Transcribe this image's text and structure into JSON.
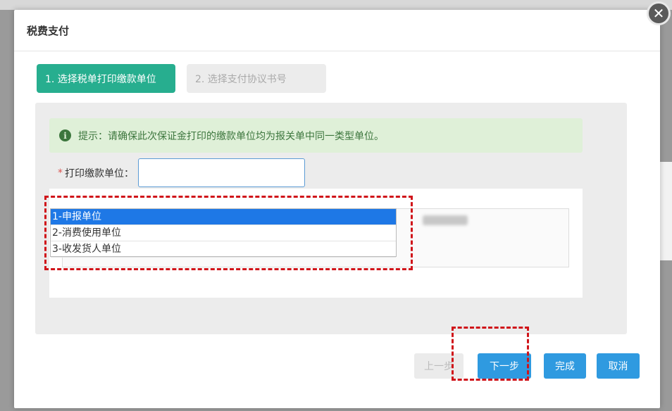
{
  "modal": {
    "title": "税费支付",
    "close_label": "✕"
  },
  "steps": [
    {
      "label": "1. 选择税单打印缴款单位",
      "active": true
    },
    {
      "label": "2. 选择支付协议书号",
      "active": false
    }
  ],
  "tip": {
    "icon": "info-icon",
    "text": "提示：请确保此次保证金打印的缴款单位均为报关单中同一类型单位。"
  },
  "form": {
    "required_mark": "*",
    "label": "打印缴款单位：",
    "value": ""
  },
  "dropdown": {
    "options": [
      "1-申报单位",
      "2-消费使用单位",
      "3-收发货人单位"
    ],
    "selected_index": 0
  },
  "buttons": {
    "prev": "上一步",
    "next": "下一步",
    "done": "完成",
    "cancel": "取消"
  },
  "colors": {
    "active_step": "#27ae8f",
    "primary_button": "#2f9ae0",
    "tip_background": "#dff0d8",
    "highlight": "#d0141a",
    "selected_option": "#1e78e6"
  }
}
